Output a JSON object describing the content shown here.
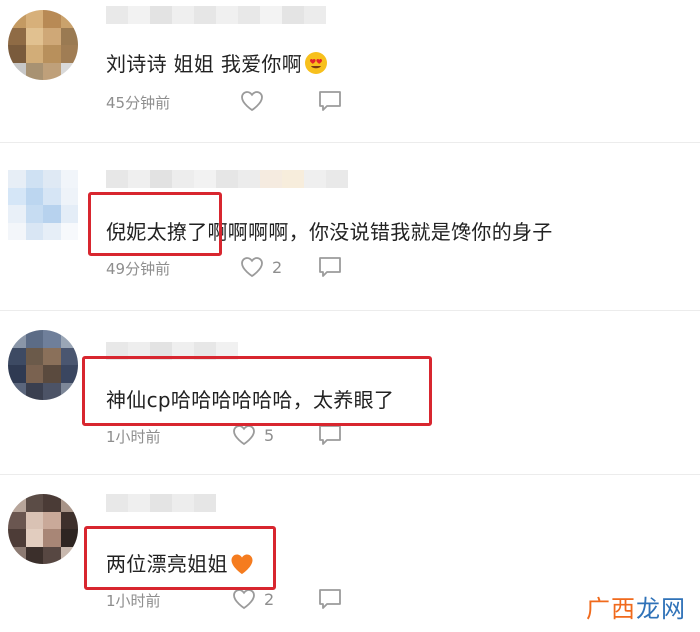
{
  "comments": [
    {
      "text": "刘诗诗 姐姐 我爱你啊",
      "emoji": "heart-eyes",
      "time": "45分钟前",
      "likes": ""
    },
    {
      "text": "倪妮太撩了啊啊啊啊，你没说错我就是馋你的身子",
      "time": "49分钟前",
      "likes": "2"
    },
    {
      "text": "神仙cp哈哈哈哈哈哈，太养眼了",
      "time": "1小时前",
      "likes": "5"
    },
    {
      "text": "两位漂亮姐姐",
      "emoji": "orange-heart",
      "time": "1小时前",
      "likes": "2"
    }
  ],
  "icons": {
    "like": "heart-outline-icon",
    "reply": "comment-icon"
  },
  "colors": {
    "highlight": "#d8262f",
    "watermark_orange": "#f06a1c",
    "watermark_blue": "#2f72b8"
  },
  "watermark": {
    "part1": "广西",
    "part2": "龙网"
  }
}
